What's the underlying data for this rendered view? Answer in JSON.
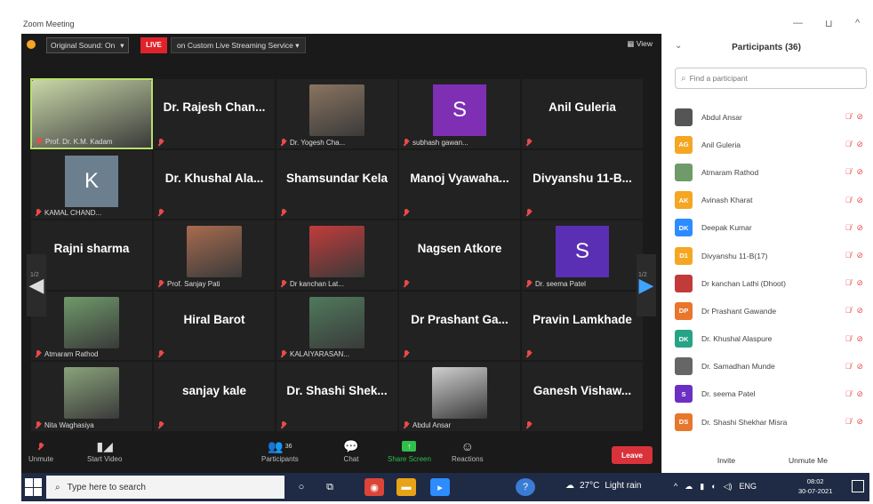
{
  "window": {
    "title": "Zoom Meeting",
    "minimize": "—",
    "restore": "⊔",
    "close": "^"
  },
  "topbar": {
    "sound_label": "Original Sound: On",
    "sound_caret": "▾",
    "live_badge": "LIVE",
    "stream_label": "on Custom Live Streaming Service ▾",
    "view_label": "▦ View"
  },
  "tiles": [
    {
      "caption": "Prof. Dr. K.M. Kadam",
      "active": true,
      "photo_color": "#c9d7a8"
    },
    {
      "big": "Dr. Rajesh Chan...",
      "caption": ""
    },
    {
      "caption": "Dr. Yogesh Cha...",
      "photo_color": "#8a7460"
    },
    {
      "letter": "S",
      "letter_bg": "#7e2fb3",
      "caption": "subhash gawan..."
    },
    {
      "big": "Anil Guleria",
      "caption": ""
    },
    {
      "letter": "K",
      "letter_bg": "#6b7f8e",
      "caption": "KAMAL CHAND..."
    },
    {
      "big": "Dr. Khushal Ala...",
      "caption": ""
    },
    {
      "big": "Shamsundar Kela",
      "caption": ""
    },
    {
      "big": "Manoj Vyawaha...",
      "caption": ""
    },
    {
      "big": "Divyanshu 11-B...",
      "caption": ""
    },
    {
      "big": "Rajni sharma",
      "caption": ""
    },
    {
      "caption": "Prof. Sanjay Pati",
      "photo_color": "#a86b4f"
    },
    {
      "caption": "Dr kanchan Lat...",
      "photo_color": "#c23b3b"
    },
    {
      "big": "Nagsen Atkore",
      "caption": ""
    },
    {
      "letter": "S",
      "letter_bg": "#5b2fb3",
      "caption": "Dr. seema Patel"
    },
    {
      "caption": "Atmaram Rathod",
      "photo_color": "#6f9a6a"
    },
    {
      "big": "Hiral Barot",
      "caption": ""
    },
    {
      "caption": "KALAIYARASAN...",
      "photo_color": "#4f7a5c"
    },
    {
      "big": "Dr Prashant Ga...",
      "caption": ""
    },
    {
      "big": "Pravin Lamkhade",
      "caption": ""
    },
    {
      "caption": "Nita Waghasiya",
      "photo_color": "#8aa37a"
    },
    {
      "big": "sanjay kale",
      "caption": ""
    },
    {
      "big": "Dr. Shashi Shek...",
      "caption": ""
    },
    {
      "caption": "Abdul Ansar",
      "photo_color": "#cfcfcf"
    },
    {
      "big": "Ganesh Vishaw...",
      "caption": ""
    }
  ],
  "pager": {
    "left": "1/2",
    "right": "1/2"
  },
  "toolbar": {
    "unmute": "Unmute",
    "start_video": "Start Video",
    "participants": "Participants",
    "participants_count": "36",
    "chat": "Chat",
    "share_screen": "Share Screen",
    "reactions": "Reactions",
    "leave": "Leave"
  },
  "panel": {
    "title": "Participants (36)",
    "search_placeholder": "Find a participant",
    "invite": "Invite",
    "unmute_me": "Unmute Me",
    "participants": [
      {
        "name": "Abdul Ansar",
        "initials": "",
        "color": "#555555"
      },
      {
        "name": "Anil Guleria",
        "initials": "AG",
        "color": "#f5a623"
      },
      {
        "name": "Atmaram Rathod",
        "initials": "",
        "color": "#6f9a6a"
      },
      {
        "name": "Avinash Kharat",
        "initials": "AK",
        "color": "#f5a623"
      },
      {
        "name": "Deepak Kumar",
        "initials": "DK",
        "color": "#2d8cff"
      },
      {
        "name": "Divyanshu 11-B(17)",
        "initials": "D1",
        "color": "#f5a623"
      },
      {
        "name": "Dr kanchan Lathi (Dhoot)",
        "initials": "",
        "color": "#c23b3b"
      },
      {
        "name": "Dr Prashant Gawande",
        "initials": "DP",
        "color": "#e8762b"
      },
      {
        "name": "Dr. Khushal Alaspure",
        "initials": "DK",
        "color": "#27a385"
      },
      {
        "name": "Dr. Samadhan Munde",
        "initials": "",
        "color": "#666666"
      },
      {
        "name": "Dr. seema Patel",
        "initials": "S",
        "color": "#6b2fc4"
      },
      {
        "name": "Dr. Shashi Shekhar Misra",
        "initials": "DS",
        "color": "#e8762b"
      }
    ]
  },
  "taskbar": {
    "search_text": "Type here to search",
    "temperature": "27°C",
    "weather": "Light rain",
    "lang": "ENG",
    "time": "08:02",
    "date": "30-07-2021"
  }
}
